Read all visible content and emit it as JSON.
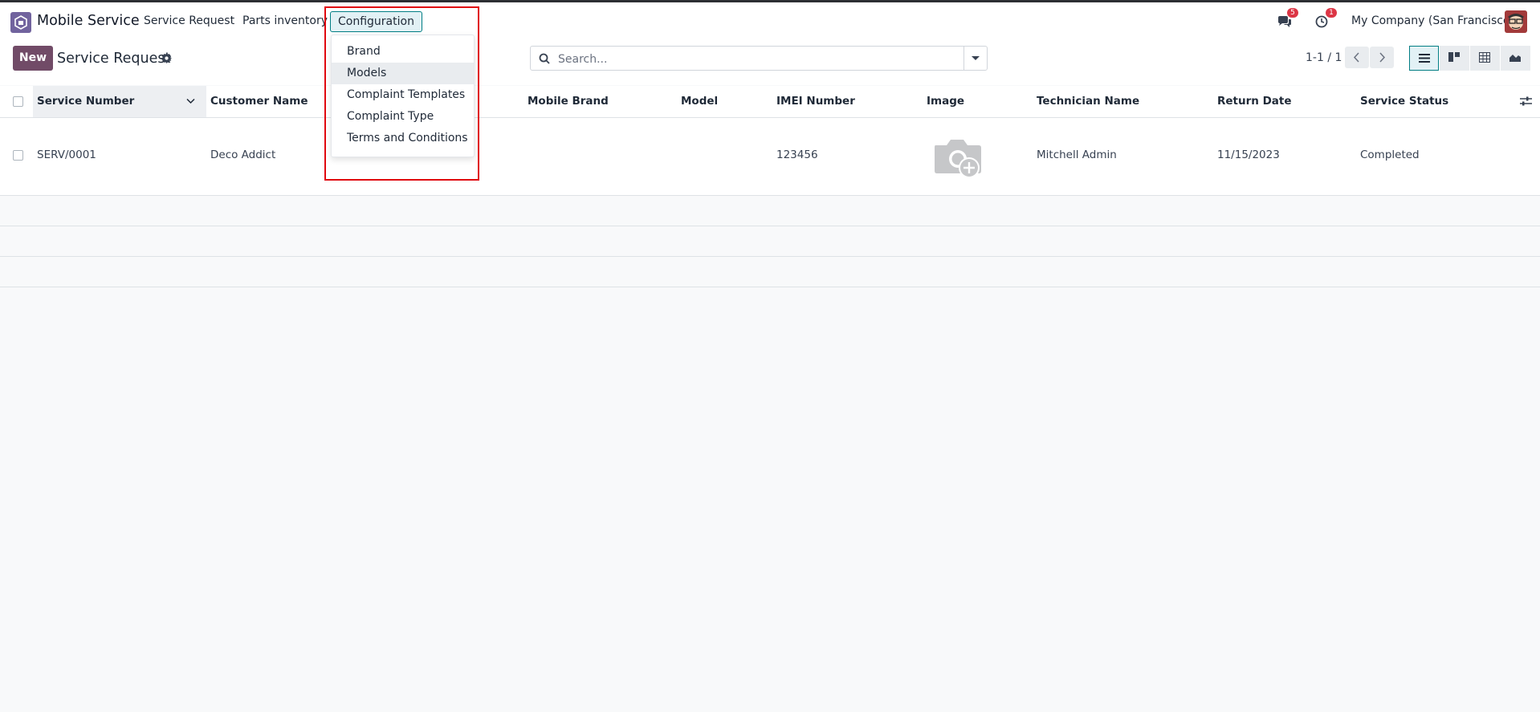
{
  "navbar": {
    "app_name": "Mobile Service",
    "menus": [
      "Service Request",
      "Parts inventory",
      "Configuration"
    ],
    "messages_count": "5",
    "activities_count": "1",
    "company": "My Company (San Francisco)"
  },
  "control_panel": {
    "new_label": "New",
    "breadcrumb": "Service Request",
    "search_placeholder": "Search...",
    "pager": "1-1 / 1"
  },
  "configuration_menu": {
    "items": [
      "Brand",
      "Models",
      "Complaint Templates",
      "Complaint Type",
      "Terms and Conditions"
    ],
    "hovered": "Models"
  },
  "list": {
    "columns": [
      "Service Number",
      "Customer Name",
      "Mobile Brand",
      "Model",
      "IMEI Number",
      "Image",
      "Technician Name",
      "Return Date",
      "Service Status"
    ],
    "rows": [
      {
        "service_number": "SERV/0001",
        "customer_name": "Deco Addict",
        "mobile_brand": "",
        "model": "",
        "imei_number": "123456",
        "technician_name": "Mitchell Admin",
        "return_date": "11/15/2023",
        "service_status": "Completed"
      }
    ]
  },
  "colors": {
    "brand": "#714b67",
    "accent": "#017e84",
    "annotation": "#e0060f",
    "badge": "#dc3545"
  }
}
